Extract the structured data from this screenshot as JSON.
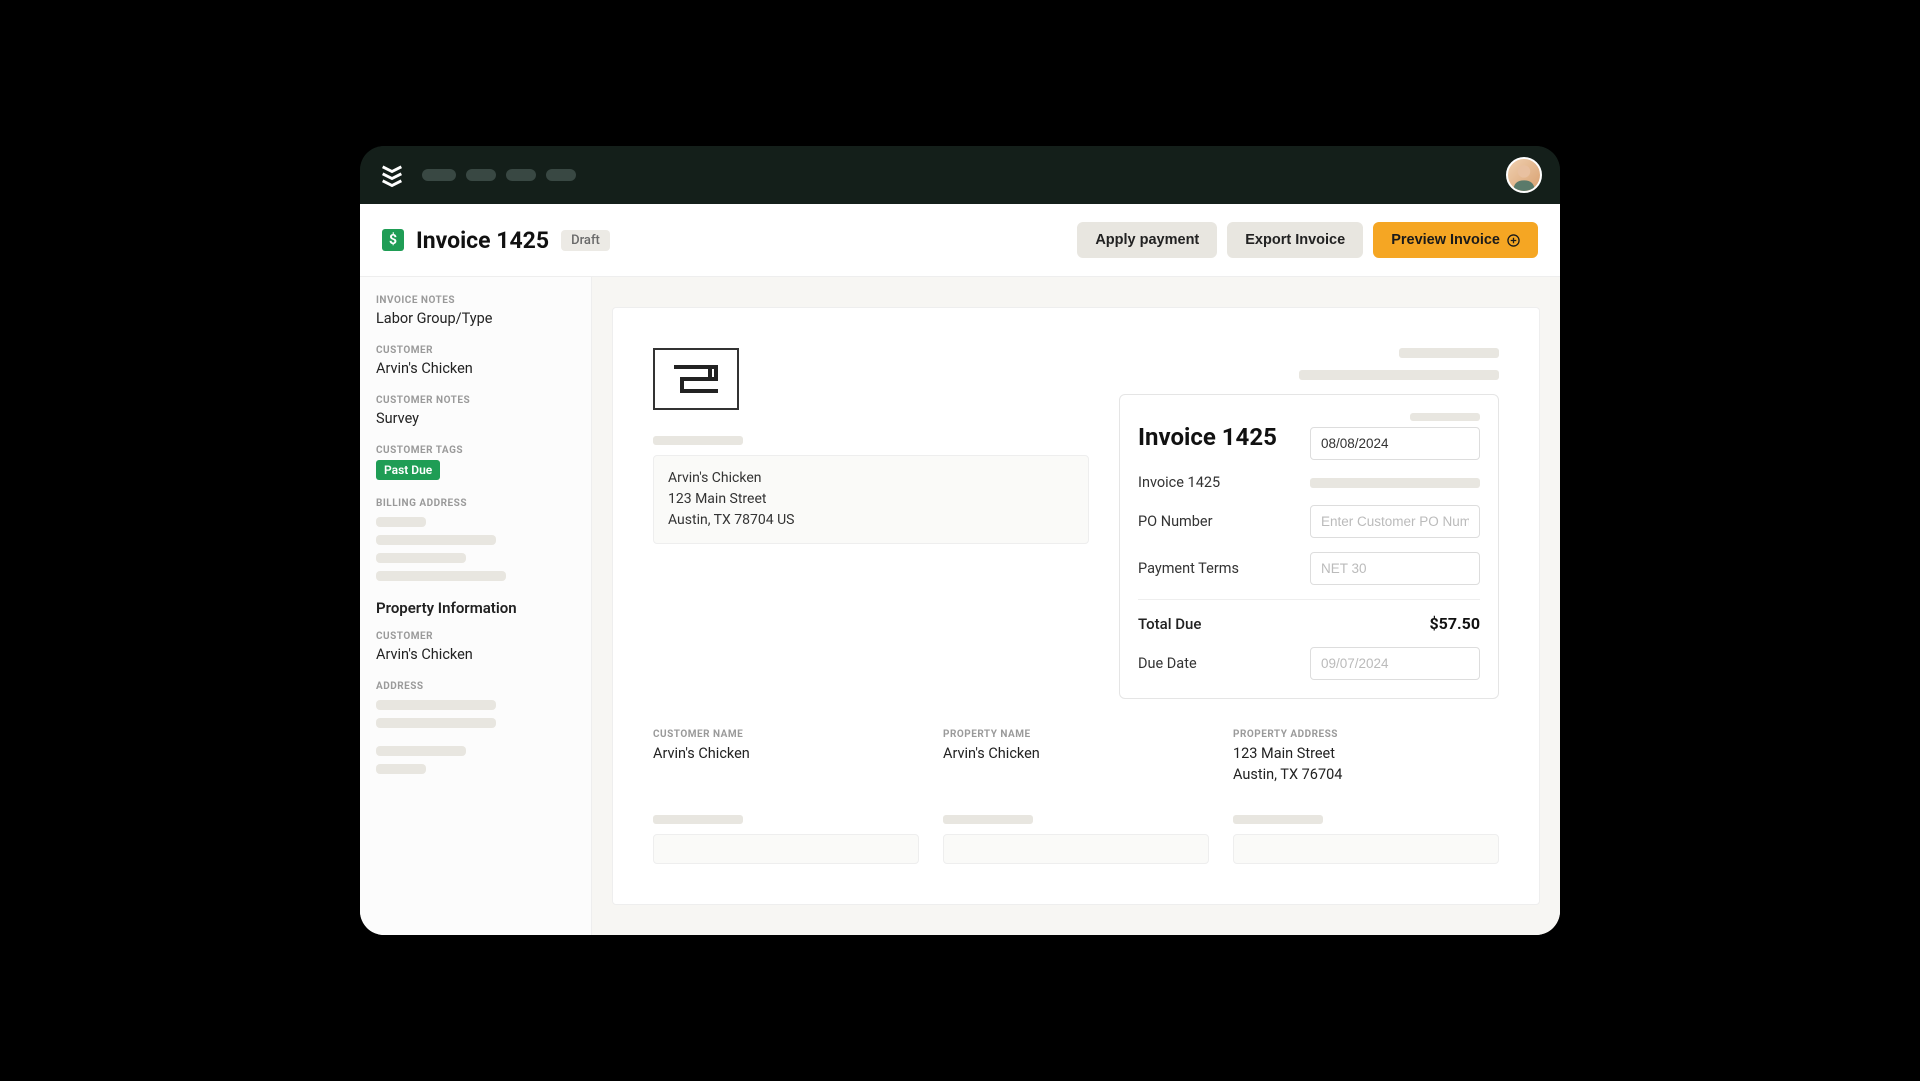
{
  "header": {
    "title": "Invoice 1425",
    "status": "Draft",
    "actions": {
      "apply_payment": "Apply payment",
      "export_invoice": "Export Invoice",
      "preview_invoice": "Preview Invoice"
    }
  },
  "sidebar": {
    "invoice_notes": {
      "label": "INVOICE NOTES",
      "value": "Labor Group/Type"
    },
    "customer": {
      "label": "CUSTOMER",
      "value": "Arvin's Chicken"
    },
    "customer_notes": {
      "label": "CUSTOMER NOTES",
      "value": "Survey"
    },
    "customer_tags": {
      "label": "CUSTOMER TAGS",
      "tag": "Past Due"
    },
    "billing_address": {
      "label": "BILLING ADDRESS"
    },
    "property_heading": "Property Information",
    "property_customer": {
      "label": "CUSTOMER",
      "value": "Arvin's Chicken"
    },
    "address": {
      "label": "ADDRESS"
    }
  },
  "invoice": {
    "bill_to": {
      "name": "Arvin's Chicken",
      "street": "123 Main Street",
      "city_state": "Austin, TX 78704 US"
    },
    "right": {
      "title": "Invoice 1425",
      "date": "08/08/2024",
      "invoice_number_label": "Invoice 1425",
      "po_label": "PO Number",
      "po_placeholder": "Enter Customer PO Num...",
      "terms_label": "Payment Terms",
      "terms_value": "NET 30",
      "total_label": "Total Due",
      "total_amount": "$57.50",
      "due_label": "Due Date",
      "due_value": "09/07/2024"
    },
    "bottom": {
      "customer_name": {
        "label": "CUSTOMER NAME",
        "value": "Arvin's Chicken"
      },
      "property_name": {
        "label": "PROPERTY NAME",
        "value": "Arvin's Chicken"
      },
      "property_address": {
        "label": "PROPERTY ADDRESS",
        "line1": "123 Main Street",
        "line2": "Austin, TX 76704"
      }
    }
  }
}
